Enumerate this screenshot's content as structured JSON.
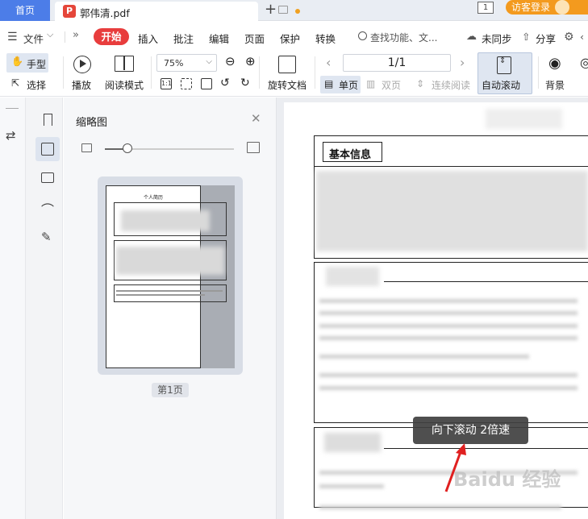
{
  "tabs": {
    "home": "首页",
    "doc_title": "郭伟清.pdf",
    "doc_badge": "P",
    "plus": "+",
    "num_badge": "1",
    "login": "访客登录"
  },
  "menu": {
    "file": "文件",
    "start": "开始",
    "items": [
      "插入",
      "批注",
      "编辑",
      "页面",
      "保护",
      "转换"
    ],
    "search": "查找功能、文...",
    "unsync": "未同步",
    "share": "分享"
  },
  "toolbar": {
    "hand": "手型",
    "select": "选择",
    "play": "播放",
    "read_mode": "阅读模式",
    "zoom": "75%",
    "rotate": "旋转文档",
    "page": "1/1",
    "single": "单页",
    "double": "双页",
    "continuous": "连续阅读",
    "auto_scroll": "自动滚动",
    "background": "背景"
  },
  "thumbnail": {
    "title": "缩略图",
    "page_label": "第1页",
    "slider_value": 0.18,
    "mini_title": "个人简历"
  },
  "document": {
    "section1": "基本信息",
    "section_blur": "自我评价"
  },
  "tooltip": "向下滚动  2倍速",
  "watermark": "Baidu 经验",
  "colors": {
    "accent": "#4c7de8",
    "start_red": "#e83d3d",
    "login_orange": "#f39a1e",
    "arrow_red": "#e02020"
  }
}
